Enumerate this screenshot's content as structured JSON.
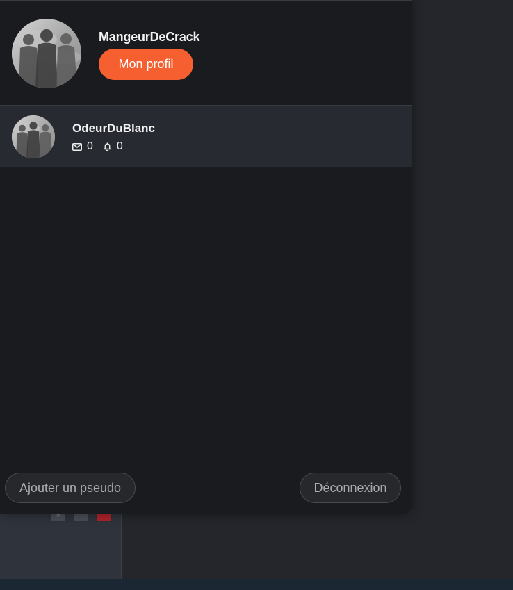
{
  "current_account": {
    "username": "MangeurDeCrack",
    "profile_button": "Mon profil"
  },
  "accounts": [
    {
      "username": "OdeurDuBlanc",
      "messages": "0",
      "notifications": "0"
    }
  ],
  "footer": {
    "add_label": "Ajouter un pseudo",
    "logout_label": "Déconnexion"
  },
  "background": {
    "icons": [
      "quote-icon",
      "sad-face-icon",
      "alert-icon"
    ]
  },
  "colors": {
    "accent": "#f66031",
    "panel": "#1a1b1e",
    "row_highlight": "#282a31"
  }
}
